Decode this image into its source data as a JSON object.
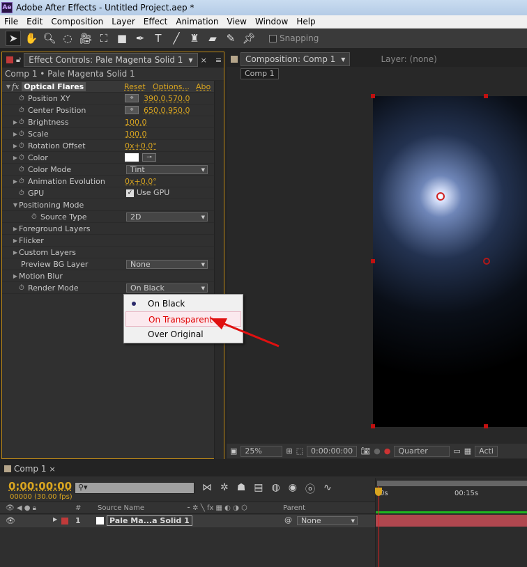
{
  "app": {
    "title": "Adobe After Effects - Untitled Project.aep *",
    "icon_text": "Ae"
  },
  "menu": [
    "File",
    "Edit",
    "Composition",
    "Layer",
    "Effect",
    "Animation",
    "View",
    "Window",
    "Help"
  ],
  "toolbar": {
    "tools": [
      "selection-tool",
      "hand-tool",
      "zoom-tool",
      "rotation-tool",
      "camera-tool",
      "pan-behind-tool",
      "rectangle-tool",
      "pen-tool",
      "type-tool",
      "brush-tool",
      "clone-stamp-tool",
      "eraser-tool",
      "roto-brush-tool",
      "puppet-pin-tool"
    ],
    "snapping_label": "Snapping",
    "snapping_checked": false
  },
  "effect_panel": {
    "tab": "Effect Controls: Pale Magenta Solid 1",
    "breadcrumb": "Comp 1 • Pale Magenta Solid 1",
    "effect_name": "Optical Flares",
    "reset": "Reset",
    "options": "Options...",
    "about": "Abo",
    "props": [
      {
        "label": "Position XY",
        "value": "390.0,570.0",
        "type": "point"
      },
      {
        "label": "Center Position",
        "value": "650.0,950.0",
        "type": "point"
      },
      {
        "label": "Brightness",
        "value": "100.0",
        "type": "num",
        "tri": true
      },
      {
        "label": "Scale",
        "value": "100.0",
        "type": "num",
        "tri": true
      },
      {
        "label": "Rotation Offset",
        "value": "0x+0.0°",
        "type": "num",
        "tri": true
      },
      {
        "label": "Color",
        "value": "",
        "type": "color",
        "tri": true
      },
      {
        "label": "Color Mode",
        "value": "Tint",
        "type": "dd"
      },
      {
        "label": "Animation Evolution",
        "value": "0x+0.0°",
        "type": "num",
        "tri": true
      },
      {
        "label": "GPU",
        "value": "Use GPU",
        "type": "check"
      },
      {
        "label": "Positioning Mode",
        "value": "",
        "type": "group",
        "open": true
      },
      {
        "label": "Source Type",
        "value": "2D",
        "type": "dd",
        "indent": true
      },
      {
        "label": "Foreground Layers",
        "value": "",
        "type": "group"
      },
      {
        "label": "Flicker",
        "value": "",
        "type": "group"
      },
      {
        "label": "Custom Layers",
        "value": "",
        "type": "group"
      },
      {
        "label": "Preview BG Layer",
        "value": "None",
        "type": "dd",
        "plain": true
      },
      {
        "label": "Motion Blur",
        "value": "",
        "type": "group"
      },
      {
        "label": "Render Mode",
        "value": "On Black",
        "type": "dd"
      }
    ],
    "dropdown_options": [
      {
        "label": "On Black",
        "selected": true
      },
      {
        "label": "On Transparent",
        "highlighted": true
      },
      {
        "label": "Over Original"
      }
    ]
  },
  "comp_panel": {
    "tab": "Composition: Comp 1",
    "layer_tab": "Layer: (none)",
    "comp_button": "Comp 1",
    "zoom": "25%",
    "timecode": "0:00:00:00",
    "resolution": "Quarter",
    "view": "Acti"
  },
  "timeline": {
    "tab": "Comp 1",
    "timecode": "0:00:00:00",
    "fps": "00000 (30.00 fps)",
    "search_placeholder": "⚲▾",
    "columns": {
      "num": "#",
      "source": "Source Name",
      "parent": "Parent"
    },
    "ruler": [
      "0s",
      "00:15s"
    ],
    "layer": {
      "num": "1",
      "name": "Pale Ma...a Solid 1",
      "parent": "None",
      "color": "#c03a3a"
    }
  },
  "colors": {
    "accent": "#d9a520",
    "layer_bar": "#b0474f",
    "annotation_arrow": "#e01010"
  }
}
